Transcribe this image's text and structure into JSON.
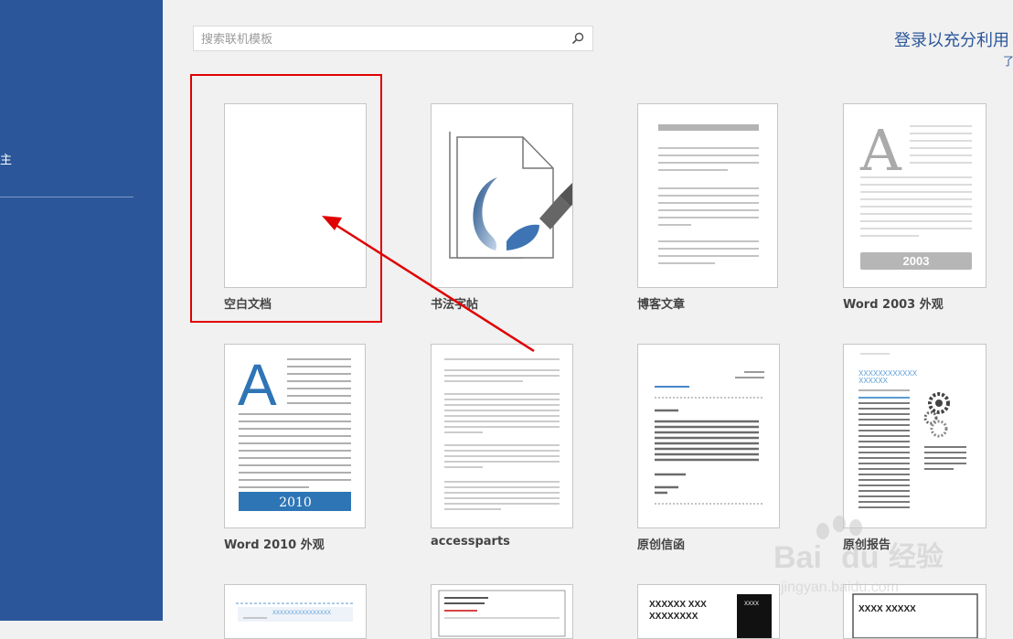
{
  "search": {
    "placeholder": "搜索联机模板"
  },
  "account": {
    "signin_text": "登录以充分利用",
    "sub_link": "了"
  },
  "sidebar": {
    "fragment": "主"
  },
  "templates": [
    {
      "label": "空白文档",
      "badge": ""
    },
    {
      "label": "书法字帖",
      "badge": ""
    },
    {
      "label": "博客文章",
      "badge": ""
    },
    {
      "label": "Word 2003 外观",
      "badge": "2003"
    },
    {
      "label": "Word 2010 外观",
      "badge": "2010"
    },
    {
      "label": "accessparts",
      "badge": ""
    },
    {
      "label": "原创信函",
      "badge": ""
    },
    {
      "label": "原创报告",
      "badge": ""
    }
  ],
  "row3": {
    "t1_text": "XXXXXXXXXXXXXXXX",
    "t3_title": "XXXXXX XXX",
    "t3_sub": "XXXXXXXX",
    "t3_side": "XXXX",
    "t4_title": "XXXX XXXXX"
  },
  "thumb_text": {
    "report_title": "XXXXXXXXXXXX",
    "report_subtitle": "XXXXXX"
  },
  "watermark": {
    "logo": "Bai",
    "logo2": "du",
    "jingyan": "经验",
    "url": "jingyan.baidu.com"
  },
  "colors": {
    "accent": "#2b579a",
    "highlight": "#e00000",
    "badge_2010": "#2e75b6",
    "badge_2003": "#b6b6b6"
  }
}
